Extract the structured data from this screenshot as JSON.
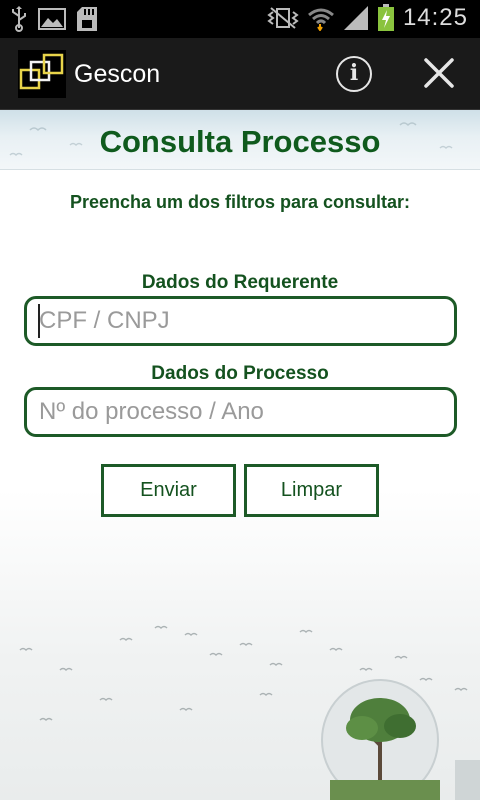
{
  "status_bar": {
    "time": "14:25",
    "icons": [
      "usb-icon",
      "image-icon",
      "sd-card-icon",
      "vibrate-icon",
      "wifi-icon",
      "signal-icon",
      "battery-charging-icon"
    ]
  },
  "action_bar": {
    "title": "Gescon",
    "info_symbol": "i"
  },
  "page": {
    "title": "Consulta Processo",
    "instructions": "Preencha um dos filtros para consultar:",
    "requerente": {
      "label": "Dados do Requerente",
      "placeholder": "CPF / CNPJ",
      "value": ""
    },
    "processo": {
      "label": "Dados do Processo",
      "placeholder": "Nº do processo / Ano",
      "value": ""
    },
    "buttons": {
      "enviar": "Enviar",
      "limpar": "Limpar"
    }
  },
  "colors": {
    "accent_green": "#14521f",
    "border_green": "#1d5a27",
    "title_green": "#0f5a1d",
    "status_bar_bg": "#000000",
    "action_bar_bg": "#1a1a1a"
  }
}
